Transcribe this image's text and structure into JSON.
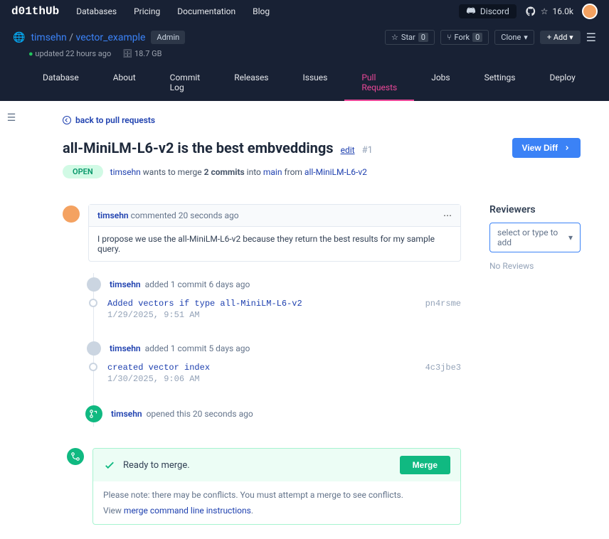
{
  "topnav": {
    "logo": "d01thUb",
    "items": [
      "Databases",
      "Pricing",
      "Documentation",
      "Blog"
    ],
    "discord": "Discord",
    "stars": "16.0k"
  },
  "repo": {
    "owner": "timsehn",
    "name": "vector_example",
    "badge": "Admin",
    "updated": "updated 22 hours ago",
    "size": "18.7 GB",
    "star": {
      "label": "Star",
      "count": "0"
    },
    "fork": {
      "label": "Fork",
      "count": "0"
    },
    "clone": "Clone",
    "add": "Add"
  },
  "tabs": [
    "Database",
    "About",
    "Commit Log",
    "Releases",
    "Issues",
    "Pull Requests",
    "Jobs",
    "Settings",
    "Deploy"
  ],
  "back": "back to pull requests",
  "pr": {
    "title": "all-MiniLM-L6-v2 is the best embveddings",
    "edit": "edit",
    "num": "#1",
    "viewdiff": "View Diff",
    "status": "OPEN",
    "author": "timsehn",
    "wants": " wants to merge ",
    "commits": "2 commits",
    "into": " into ",
    "main": "main",
    "from": " from ",
    "branch": "all-MiniLM-L6-v2"
  },
  "reviewers": {
    "title": "Reviewers",
    "placeholder": "select or type to add",
    "none": "No Reviews"
  },
  "comment": {
    "author": "timsehn",
    "when": "commented 20 seconds ago",
    "body": "I propose we use the all-MiniLM-L6-v2 because they return the best results for my sample query."
  },
  "events": [
    {
      "author": "timsehn",
      "text": "added 1 commit 6 days ago"
    },
    {
      "author": "timsehn",
      "text": "added 1 commit 5 days ago"
    },
    {
      "author": "timsehn",
      "text": "opened this 20 seconds ago"
    }
  ],
  "commits": [
    {
      "msg": "Added vectors if type all-MiniLM-L6-v2",
      "date": "1/29/2025, 9:51 AM",
      "hash": "pn4rsme"
    },
    {
      "msg": "created vector index",
      "date": "1/30/2025, 9:06 AM",
      "hash": "4c3jbe3"
    }
  ],
  "merge": {
    "ready": "Ready to merge.",
    "btn": "Merge",
    "note": "Please note: there may be conflicts. You must attempt a merge to see conflicts.",
    "view": "View ",
    "link": "merge command line instructions"
  }
}
